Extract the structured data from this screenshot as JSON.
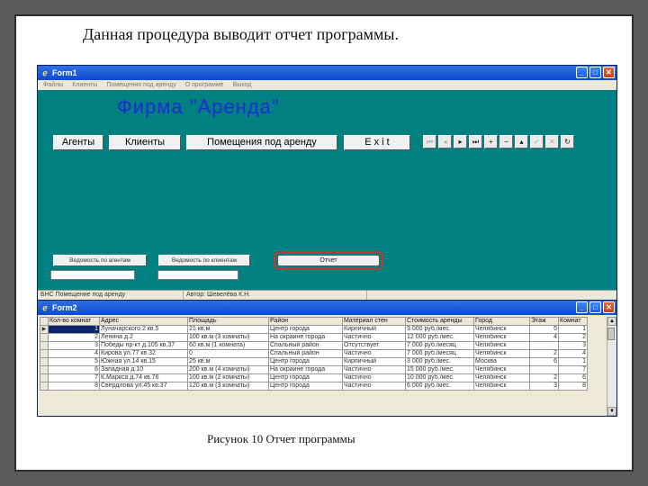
{
  "slide": {
    "title": "Данная процедура выводит отчет программы.",
    "caption": "Рисунок 10 Отчет программы"
  },
  "form1": {
    "title": "Form1",
    "menu": [
      "Файлы",
      "Клиенты",
      "Помещения под аренду",
      "О программе",
      "Выход"
    ],
    "heading": "Фирма \"Аренда\"",
    "buttons": {
      "agents": "Агенты",
      "clients": "Клиенты",
      "premises": "Помещения под аренду",
      "exit": "E x i t"
    },
    "navigator": {
      "first": "⏮",
      "prior": "◂",
      "next": "▸",
      "last": "⏭",
      "insert": "+",
      "delete": "−",
      "edit": "▴",
      "post": "✓",
      "cancel": "✕",
      "refresh": "↻"
    },
    "lower_buttons": {
      "left": "Ведомость по агентам",
      "mid": "Ведомость по клиентам",
      "ok": "Отчет"
    },
    "status": {
      "left": "БНС Помещение под аренду",
      "right": "Автор: Шевелёва К.Н."
    }
  },
  "form2": {
    "title": "Form2",
    "columns": [
      "Кол-во комнат",
      "Адрес",
      "Площадь",
      "Район",
      "Материал стен",
      "Стоимость аренды",
      "Город",
      "Этаж",
      "Комнат"
    ],
    "rows": [
      [
        "1",
        "Луначарского 2 кв.5",
        "21 кв.м",
        "Центр города",
        "Кирпичный",
        "3 000 руб./мес.",
        "Челябинск",
        "5",
        "1"
      ],
      [
        "2",
        "Ленина д.2",
        "100 кв.м (3 комнаты)",
        "На окраине города",
        "Частично",
        "12 000 руб./мес.",
        "Челябинск",
        "4",
        "2"
      ],
      [
        "3",
        "Победы пр-кт д.105 кв.37",
        "60 кв.м (1 комната)",
        "Спальный район",
        "Отсутствует",
        "7 000 руб./месяц",
        "Челябинск",
        "",
        "3"
      ],
      [
        "4",
        "Кирова ул.77 кв.32",
        "0",
        "Спальный район",
        "Частично",
        "7 000 руб./месяц",
        "Челябинск",
        "2",
        "4"
      ],
      [
        "5",
        "Южная ул.14 кв.15",
        "25 кв.м",
        "Центр города",
        "Кирпичный",
        "3 000 руб./мес.",
        "Москва",
        "6",
        "1"
      ],
      [
        "6",
        "Западная д.10",
        "200 кв.м (4 комнаты)",
        "На окраине города",
        "Частично",
        "15 000 руб./мес.",
        "Челябинск",
        "",
        "7"
      ],
      [
        "7",
        "К.Маркса д.74 кв.76",
        "100 кв.м (2 комнаты)",
        "Центр города",
        "Частично",
        "10 000 руб./мес.",
        "Челябинск",
        "2",
        "6"
      ],
      [
        "8",
        "Свердлова ул.45 кв.37",
        "120 кв.м (3 комнаты)",
        "Центр города",
        "Частично",
        "6 000 руб./мес.",
        "Челябинск",
        "3",
        "8"
      ]
    ]
  },
  "colors": {
    "teal": "#008080",
    "heading": "#1e2bd6",
    "titlebar": "#0b4bd1"
  },
  "icons": {
    "app": "delphi-icon",
    "minimize": "minimize-icon",
    "maximize": "maximize-icon",
    "close": "close-icon"
  }
}
